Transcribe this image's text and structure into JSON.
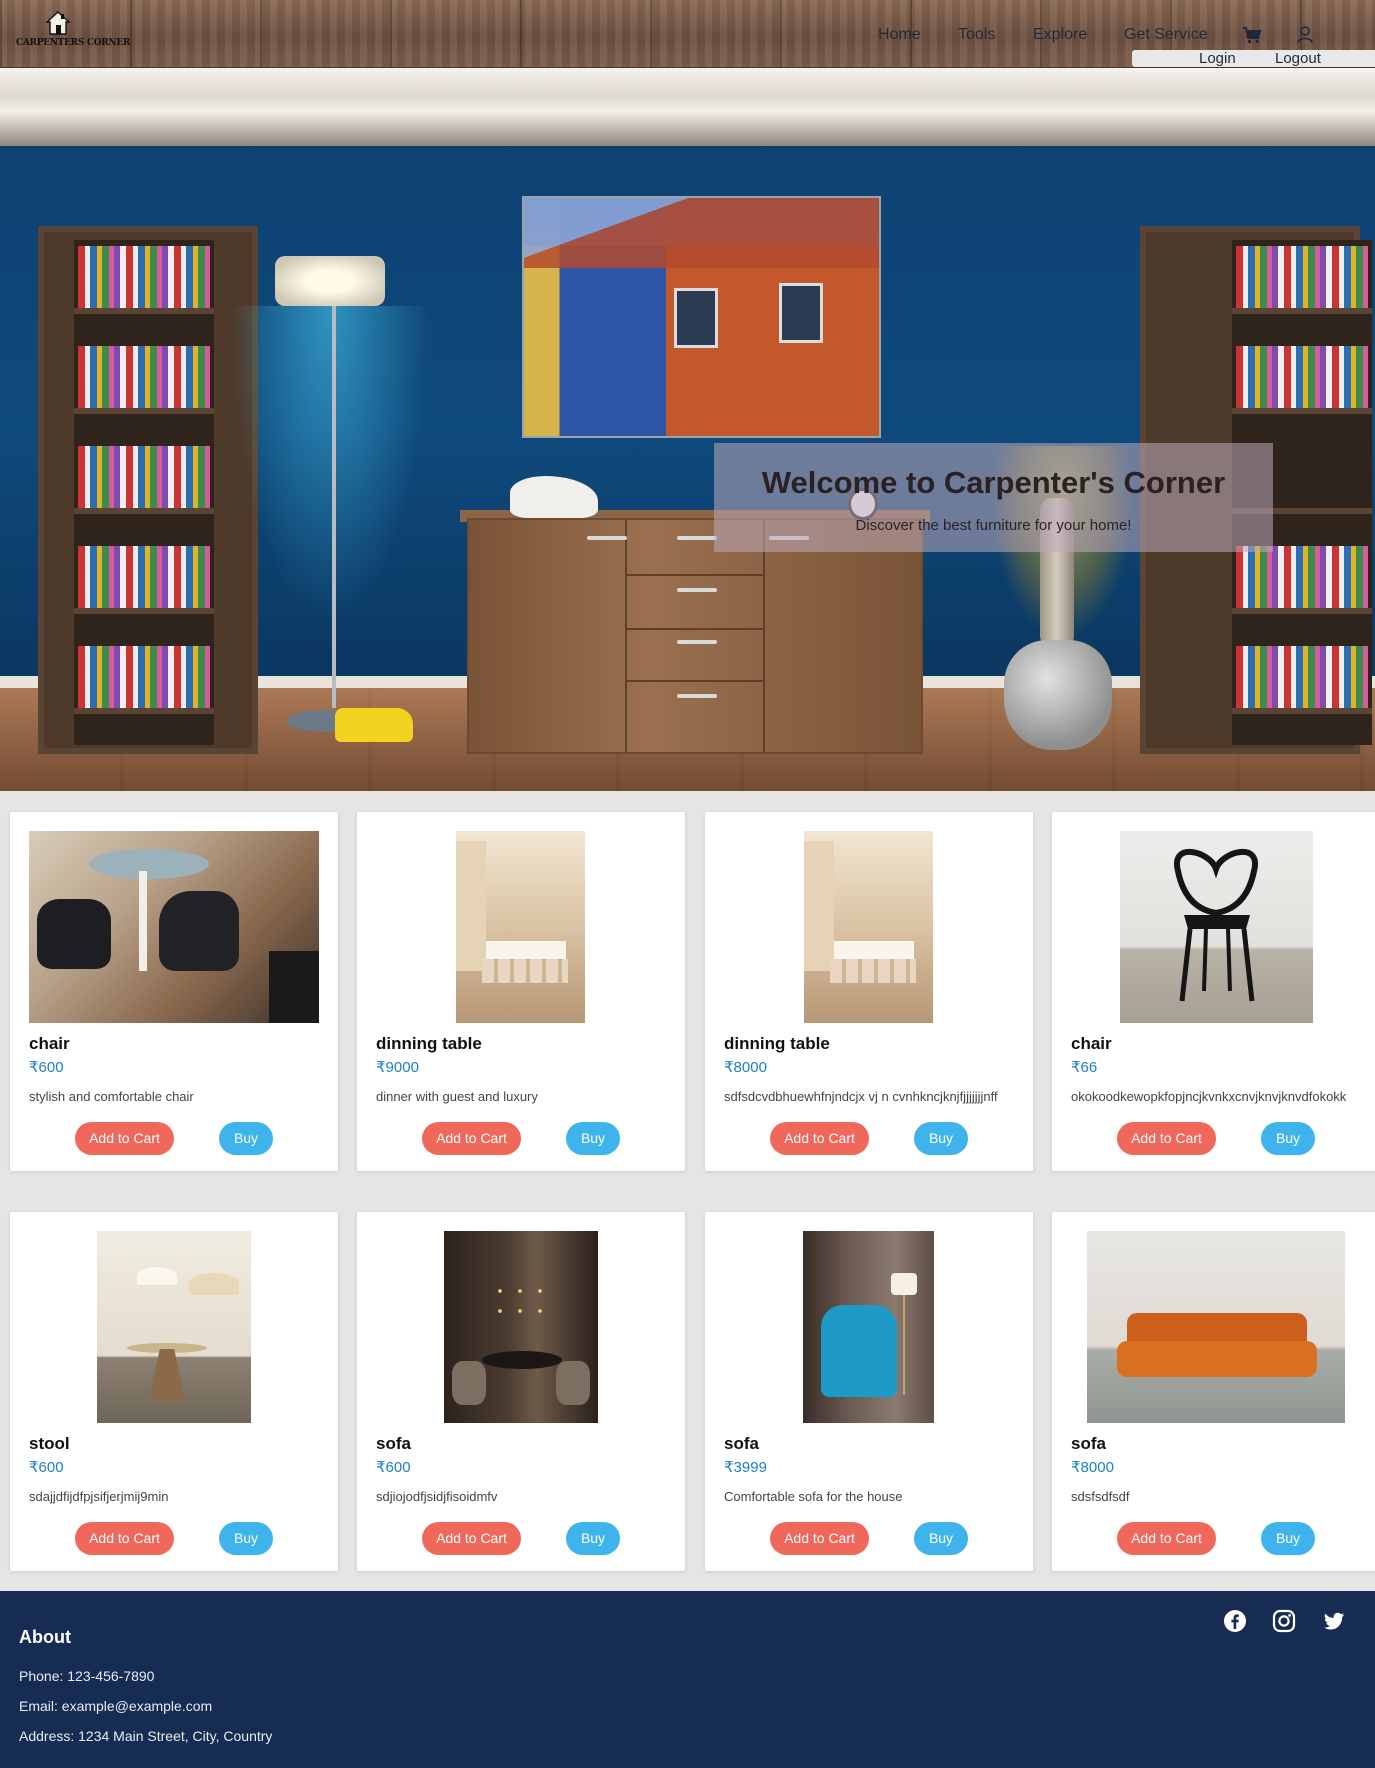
{
  "header": {
    "logo_text": "CARPENTERS CORNER",
    "nav": [
      "Home",
      "Tools",
      "Explore",
      "Get Service"
    ],
    "login": "Login",
    "logout": "Logout",
    "icons": [
      "cart-icon",
      "user-icon"
    ]
  },
  "hero": {
    "title": "Welcome to Carpenter's Corner",
    "subtitle": "Discover the best furniture for your home!"
  },
  "products": [
    {
      "name": "chair",
      "price": "₹600",
      "description": "stylish and comfortable chair",
      "add_to_cart": "Add to Cart",
      "buy": "Buy"
    },
    {
      "name": "dinning table",
      "price": "₹9000",
      "description": "dinner with guest and luxury",
      "add_to_cart": "Add to Cart",
      "buy": "Buy"
    },
    {
      "name": "dinning table",
      "price": "₹8000",
      "description": "sdfsdcvdbhuewhfnjndcjx vj n cvnhkncjknjfjjjjjjjnff",
      "add_to_cart": "Add to Cart",
      "buy": "Buy"
    },
    {
      "name": "chair",
      "price": "₹66",
      "description": "okokoodkewopkfopjncjkvnkxcnvjknvjknvdfokokk",
      "add_to_cart": "Add to Cart",
      "buy": "Buy"
    },
    {
      "name": "stool",
      "price": "₹600",
      "description": "sdajjdfijdfpjsifjerjmij9min",
      "add_to_cart": "Add to Cart",
      "buy": "Buy"
    },
    {
      "name": "sofa",
      "price": "₹600",
      "description": "sdjiojodfjsidjfisoidmfv",
      "add_to_cart": "Add to Cart",
      "buy": "Buy"
    },
    {
      "name": "sofa",
      "price": "₹3999",
      "description": "Comfortable sofa for the house",
      "add_to_cart": "Add to Cart",
      "buy": "Buy"
    },
    {
      "name": "sofa",
      "price": "₹8000",
      "description": "sdsfsdfsdf",
      "add_to_cart": "Add to Cart",
      "buy": "Buy"
    }
  ],
  "footer": {
    "heading": "About",
    "phone": "Phone: 123-456-7890",
    "email": "Email: example@example.com",
    "address": "Address: 1234 Main Street, City, Country",
    "social_icons": [
      "facebook-icon",
      "instagram-icon",
      "twitter-icon"
    ]
  },
  "colors": {
    "add_to_cart": "#f0685a",
    "buy": "#3fb4ec",
    "price": "#1d7fc4",
    "footer_bg": "#162c52"
  }
}
